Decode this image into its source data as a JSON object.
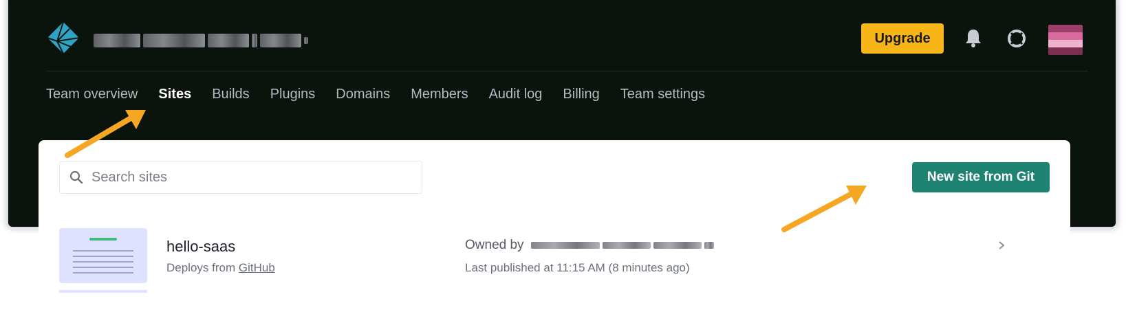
{
  "header": {
    "team_name_redacted": true,
    "upgrade_label": "Upgrade"
  },
  "icons": {
    "logo": "netlify-logo-icon",
    "bell": "bell-icon",
    "help": "lifebuoy-icon",
    "search": "search-icon",
    "chevron": "chevron-right-icon"
  },
  "tabs": [
    {
      "label": "Team overview",
      "active": false
    },
    {
      "label": "Sites",
      "active": true
    },
    {
      "label": "Builds",
      "active": false
    },
    {
      "label": "Plugins",
      "active": false
    },
    {
      "label": "Domains",
      "active": false
    },
    {
      "label": "Members",
      "active": false
    },
    {
      "label": "Audit log",
      "active": false
    },
    {
      "label": "Billing",
      "active": false
    },
    {
      "label": "Team settings",
      "active": false
    }
  ],
  "search": {
    "placeholder": "Search sites",
    "value": ""
  },
  "new_site_label": "New site from Git",
  "sites": [
    {
      "name": "hello-saas",
      "deploys_prefix": "Deploys from",
      "deploys_source": "GitHub",
      "owned_by_label": "Owned by",
      "owner_redacted": true,
      "last_published": "Last published at 11:15 AM (8 minutes ago)"
    }
  ],
  "colors": {
    "shell_bg": "#0b130d",
    "upgrade_bg": "#f8b518",
    "primary_btn_bg": "#1f8374",
    "arrow": "#f5a623"
  }
}
